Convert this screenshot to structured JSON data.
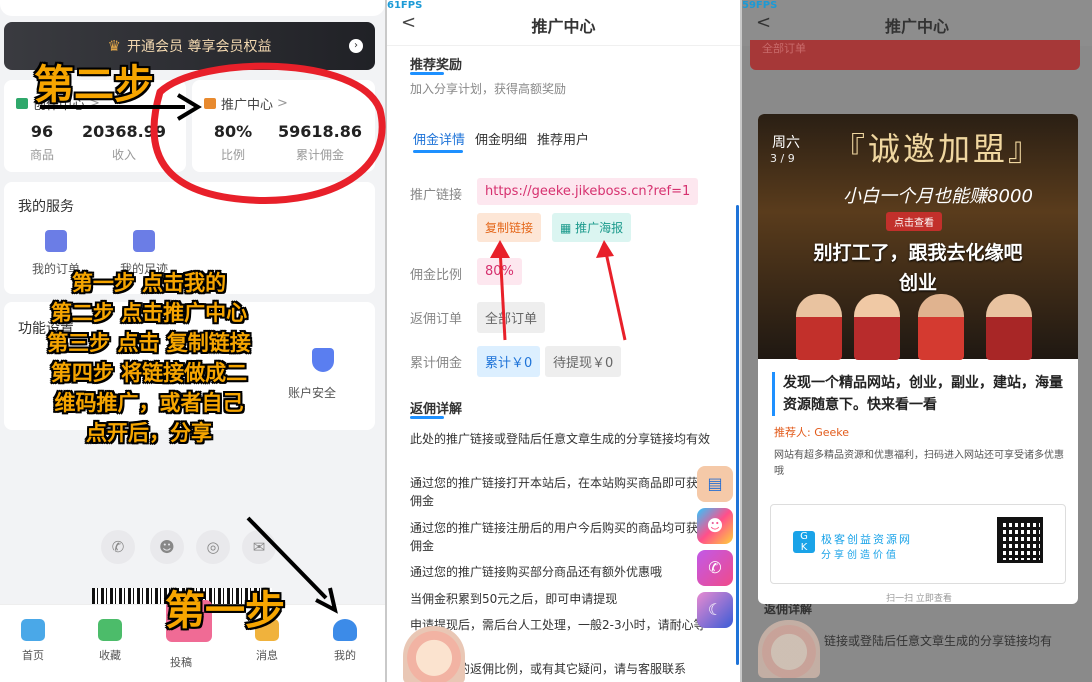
{
  "fps": {
    "left": "61FPS",
    "right": "59FPS"
  },
  "annotations": {
    "step2": "第二步",
    "step1": "第一步",
    "instructions": [
      "第一步 点击我的",
      "第二步 点击推广中心",
      "第三步 点击 复制链接",
      "第四步 将链接做成二",
      "维码推广，或者自己",
      "点开后，分享"
    ]
  },
  "me_page": {
    "vip_bar": "开通会员 尊享会员权益",
    "creator_center": "创作中心",
    "creator_center_arrow": ">",
    "promo_center": "推广中心",
    "promo_center_arrow": ">",
    "stats_left": [
      {
        "value": "96",
        "label": "商品"
      },
      {
        "value": "20368.99",
        "label": "收入"
      }
    ],
    "stats_right": [
      {
        "value": "80%",
        "label": "比例"
      },
      {
        "value": "59618.86",
        "label": "累计佣金"
      }
    ],
    "services_title": "我的服务",
    "services": [
      "我的订单",
      "我的足迹"
    ],
    "functions_title": "功能设置",
    "account_security": "账户安全",
    "tabs": [
      "首页",
      "收藏",
      "投稿",
      "消息",
      "我的"
    ]
  },
  "promo_page": {
    "back": "<",
    "title": "推广中心",
    "section_reward": "推荐奖励",
    "reward_sub": "加入分享计划，获得高额奖励",
    "tabs": [
      "佣金详情",
      "佣金明细",
      "推荐用户"
    ],
    "link_label": "推广链接",
    "link_value": "https://geeke.jikeboss.cn?ref=1",
    "copy_button": "复制链接",
    "poster_button": "推广海报",
    "rate_label": "佣金比例",
    "rate_value": "80%",
    "order_label": "返佣订单",
    "order_value": "全部订单",
    "total_label": "累计佣金",
    "total_value": "累计￥0",
    "pending_value": "待提现￥0",
    "section_detail": "返佣详解",
    "details": [
      "此处的推广链接或登陆后任意文章生成的分享链接均有效",
      "通过您的推广链接打开本站后，在本站购买商品即可获得佣金",
      "通过您的推广链接注册后的用户今后购买的商品均可获得佣金",
      "通过您的推广链接购买部分商品还有额外优惠哦",
      "当佣金积累到50元之后，即可申请提现",
      "申请提现后，需后台人工处理，一般2-3小时，请耐心等待",
      "如需更高的返佣比例，或有其它疑问，请与客服联系"
    ]
  },
  "poster_page": {
    "back": "<",
    "title": "推广中心",
    "bg_order": "全部订单",
    "bg_section": "返佣详解",
    "bg_detail": "链接或登陆后任意文章生成的分享链接均有",
    "banner_day": "周六",
    "banner_date": "3 / 9",
    "banner_h1": "『诚邀加盟』",
    "banner_h2": "小白一个月也能赚8000",
    "banner_btn": "点击查看",
    "banner_h3": "别打工了，跟我去化缘吧",
    "banner_h4": "创业",
    "headline": "发现一个精品网站，创业，副业，建站，海量资源随意下。快来看一看",
    "recommender": "推荐人: Geeke",
    "desc": "网站有超多精品资源和优惠福利，扫码进入网站还可享受诸多优惠哦",
    "logo_line1": "极客创益资源网",
    "logo_line2": "分享创造价值",
    "scan_label": "扫一扫 立即查看"
  }
}
